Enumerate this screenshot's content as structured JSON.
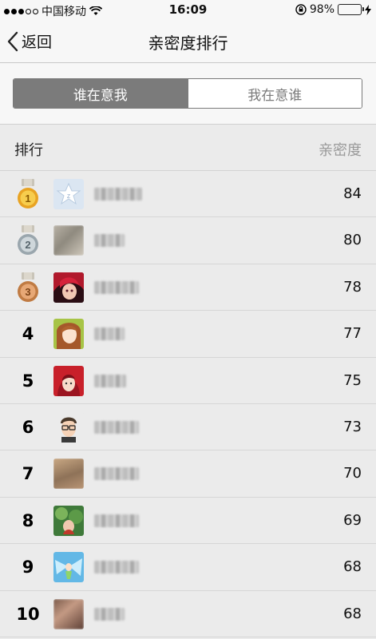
{
  "status_bar": {
    "carrier": "中国移动",
    "time": "16:09",
    "battery": "98%",
    "battery_level": 0.98
  },
  "nav": {
    "back_label": "返回",
    "title": "亲密度排行"
  },
  "tabs": [
    {
      "label": "谁在意我",
      "active": true
    },
    {
      "label": "我在意谁",
      "active": false
    }
  ],
  "list_header": {
    "rank_label": "排行",
    "score_label": "亲密度"
  },
  "rows": [
    {
      "rank": "1",
      "medal": "gold-medal-icon",
      "avatar": "star-avatar",
      "score": "84"
    },
    {
      "rank": "2",
      "medal": "silver-medal-icon",
      "avatar": "blurred-photo-avatar",
      "score": "80"
    },
    {
      "rank": "3",
      "medal": "bronze-medal-icon",
      "avatar": "anime-girl-avatar",
      "score": "78"
    },
    {
      "rank": "4",
      "medal": "",
      "avatar": "cartoon-girl-avatar",
      "score": "77"
    },
    {
      "rank": "5",
      "medal": "",
      "avatar": "red-hood-avatar",
      "score": "75"
    },
    {
      "rank": "6",
      "medal": "",
      "avatar": "glasses-boy-avatar",
      "score": "73"
    },
    {
      "rank": "7",
      "medal": "",
      "avatar": "photo-avatar",
      "score": "70"
    },
    {
      "rank": "8",
      "medal": "",
      "avatar": "nature-photo-avatar",
      "score": "69"
    },
    {
      "rank": "9",
      "medal": "",
      "avatar": "fairy-avatar",
      "score": "68"
    },
    {
      "rank": "10",
      "medal": "",
      "avatar": "blurred-portrait-avatar",
      "score": "68"
    }
  ]
}
